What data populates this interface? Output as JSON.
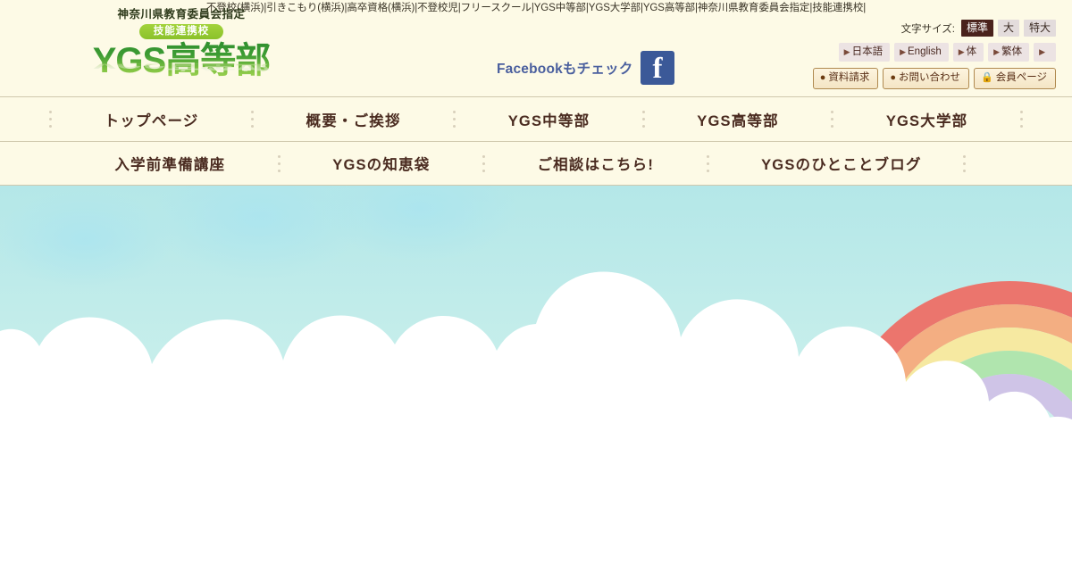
{
  "keywords_strip": "不登校(横浜)|引きこもり(横浜)|高卒資格(横浜)|不登校児|フリースクール|YGS中等部|YGS大学部|YGS高等部|神奈川県教育委員会指定|技能連携校|",
  "logo": {
    "line1": "神奈川県教育委員会指定",
    "badge": "技能連携校",
    "main": "YGS高等部",
    "reflection": "YGS高等部"
  },
  "facebook": {
    "text": "Facebookもチェック",
    "icon_letter": "f"
  },
  "text_size": {
    "label": "文字サイズ:",
    "options": [
      {
        "label": "標準",
        "active": true
      },
      {
        "label": "大",
        "active": false
      },
      {
        "label": "特大",
        "active": false
      }
    ]
  },
  "languages": [
    {
      "label": "日本語",
      "arrow": "▶"
    },
    {
      "label": "English",
      "arrow": "▶"
    },
    {
      "label": "体",
      "arrow": "▶"
    },
    {
      "label": "繁体",
      "arrow": "▶"
    },
    {
      "label": "",
      "arrow": "▶"
    }
  ],
  "actions": [
    {
      "label": "資料請求",
      "icon": "◉",
      "icon_name": "arrow-circle-icon"
    },
    {
      "label": "お問い合わせ",
      "icon": "◉",
      "icon_name": "arrow-circle-icon"
    },
    {
      "label": "会員ページ",
      "icon": "🔒",
      "icon_name": "lock-icon"
    }
  ],
  "nav_row1": [
    "トップページ",
    "概要・ご挨拶",
    "YGS中等部",
    "YGS高等部",
    "YGS大学部"
  ],
  "nav_row2": [
    "入学前準備講座",
    "YGSの知恵袋",
    "ご相談はこちら!",
    "YGSのひとことブログ"
  ],
  "hero": {
    "sky_color": "#bfeaea",
    "cloud_color": "#ffffff",
    "bird_color": "#5cc4ae",
    "rainbow_bands": [
      "#ef6a62",
      "#f7a878",
      "#fae89a",
      "#aee4a8",
      "#cfc0e6",
      "#b9e4e0"
    ]
  }
}
